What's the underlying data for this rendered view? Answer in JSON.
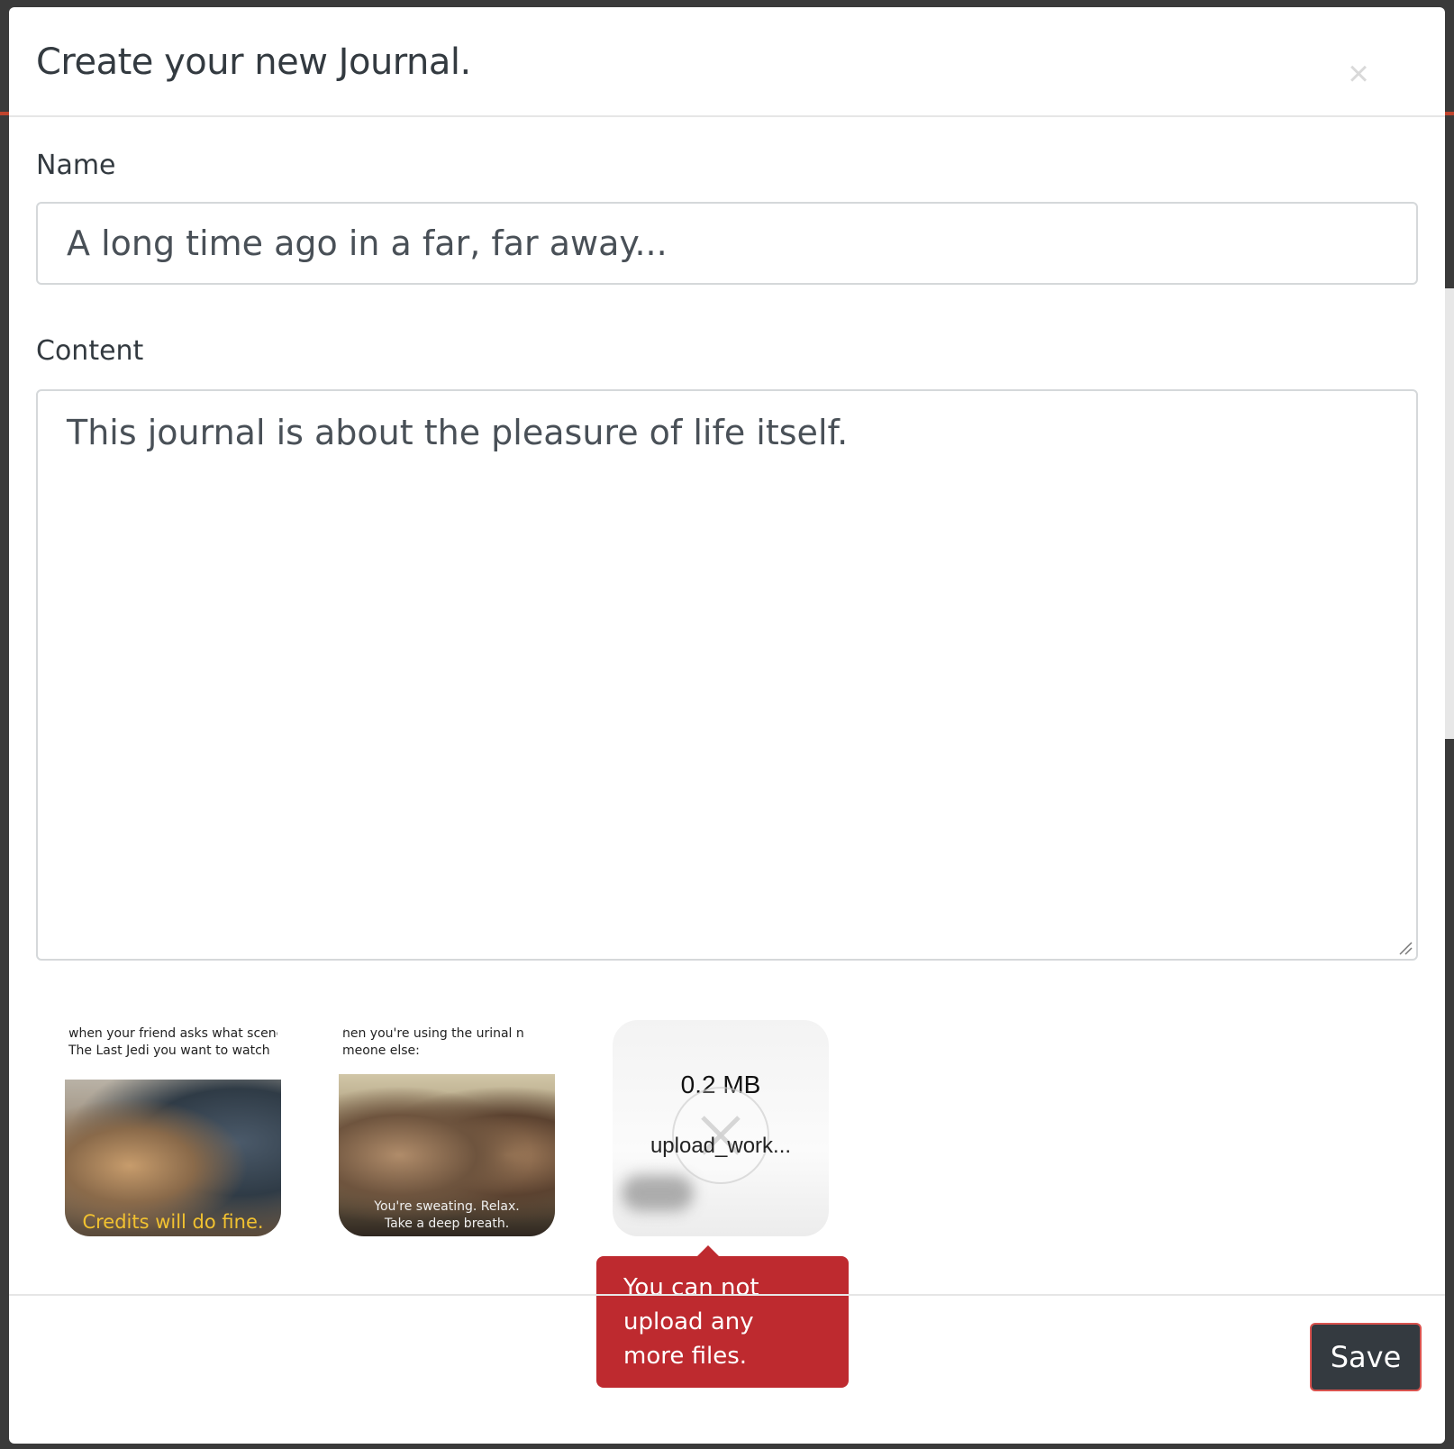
{
  "modal": {
    "title": "Create your new Journal.",
    "close_icon": "×"
  },
  "form": {
    "name_label": "Name",
    "name_value": "A long time ago in a far, far away...",
    "content_label": "Content",
    "content_value": "This journal is about the pleasure of life itself."
  },
  "uploads": [
    {
      "caption_line1": "when your friend asks what scene of",
      "caption_line2": "The Last Jedi you want to watch",
      "subtitle": "Credits will do fine."
    },
    {
      "caption_line1": "hen you're using the urinal n",
      "caption_line2": "meone else:",
      "subtitle_line1": "You're sweating. Relax.",
      "subtitle_line2": "Take a deep breath."
    },
    {
      "size": "0.2 MB",
      "filename": "upload_work..."
    }
  ],
  "error_tooltip": "You can not upload any more files.",
  "footer": {
    "save_label": "Save"
  },
  "colors": {
    "error_red": "#be2a2f",
    "button_dark": "#343a40",
    "accent": "#c0442d"
  }
}
